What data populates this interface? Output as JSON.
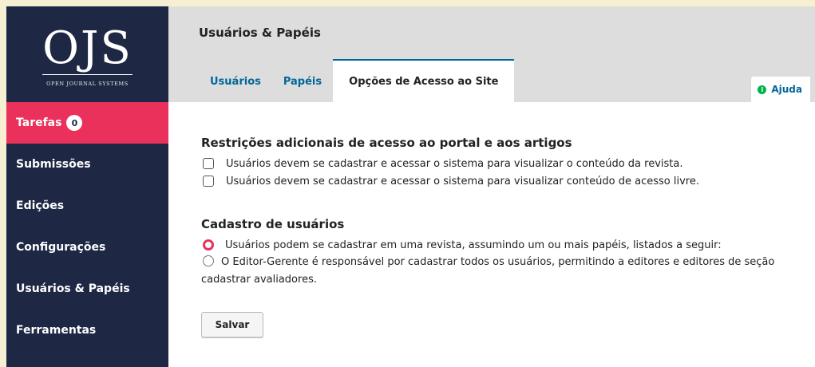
{
  "logo": {
    "text": "OJS",
    "subtitle": "OPEN JOURNAL SYSTEMS"
  },
  "sidebar": {
    "items": [
      {
        "label": "Tarefas",
        "badge": "0",
        "active": true
      },
      {
        "label": "Submissões"
      },
      {
        "label": "Edições"
      },
      {
        "label": "Configurações"
      },
      {
        "label": "Usuários & Papéis"
      },
      {
        "label": "Ferramentas"
      }
    ]
  },
  "header": {
    "title": "Usuários & Papéis",
    "tabs": [
      {
        "label": "Usuários"
      },
      {
        "label": "Papéis"
      },
      {
        "label": "Opções de Acesso ao Site",
        "selected": true
      }
    ],
    "help_label": "Ajuda",
    "help_icon": "i"
  },
  "access": {
    "title": "Restrições adicionais de acesso ao portal e aos artigos",
    "options": [
      {
        "label": "Usuários devem se cadastrar e acessar o sistema para visualizar o conteúdo da revista.",
        "checked": false
      },
      {
        "label": "Usuários devem se cadastrar e acessar o sistema para visualizar conteúdo de acesso livre.",
        "checked": false
      }
    ]
  },
  "registration": {
    "title": "Cadastro de usuários",
    "options": [
      {
        "label": "Usuários podem se cadastrar em uma revista, assumindo um ou mais papéis, listados a seguir:",
        "selected": true
      },
      {
        "label": "O Editor-Gerente é responsável por cadastrar todos os usuários, permitindo a editores e editores de seção cadastrar avaliadores.",
        "selected": false
      }
    ]
  },
  "save_label": "Salvar",
  "colors": {
    "sidebar": "#1e2844",
    "accent": "#e9315b",
    "link": "#006798",
    "help": "#00b24e"
  }
}
